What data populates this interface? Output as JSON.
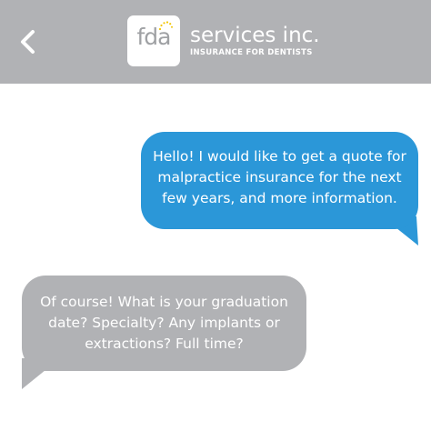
{
  "header": {
    "back_icon": "chevron-left-icon",
    "logo_text": "fda",
    "brand_name": "services inc.",
    "tagline": "INSURANCE FOR DENTISTS",
    "background_color": "#b1b2b5"
  },
  "messages": [
    {
      "direction": "outgoing",
      "color": "#2b97d8",
      "text": "Hello! I would like to get a quote for malpractice insurance for the next few years, and more information."
    },
    {
      "direction": "incoming",
      "color": "#b1b2b5",
      "text": "Of course! What is your graduation date? Specialty? Any implants or extractions? Full time?"
    }
  ]
}
